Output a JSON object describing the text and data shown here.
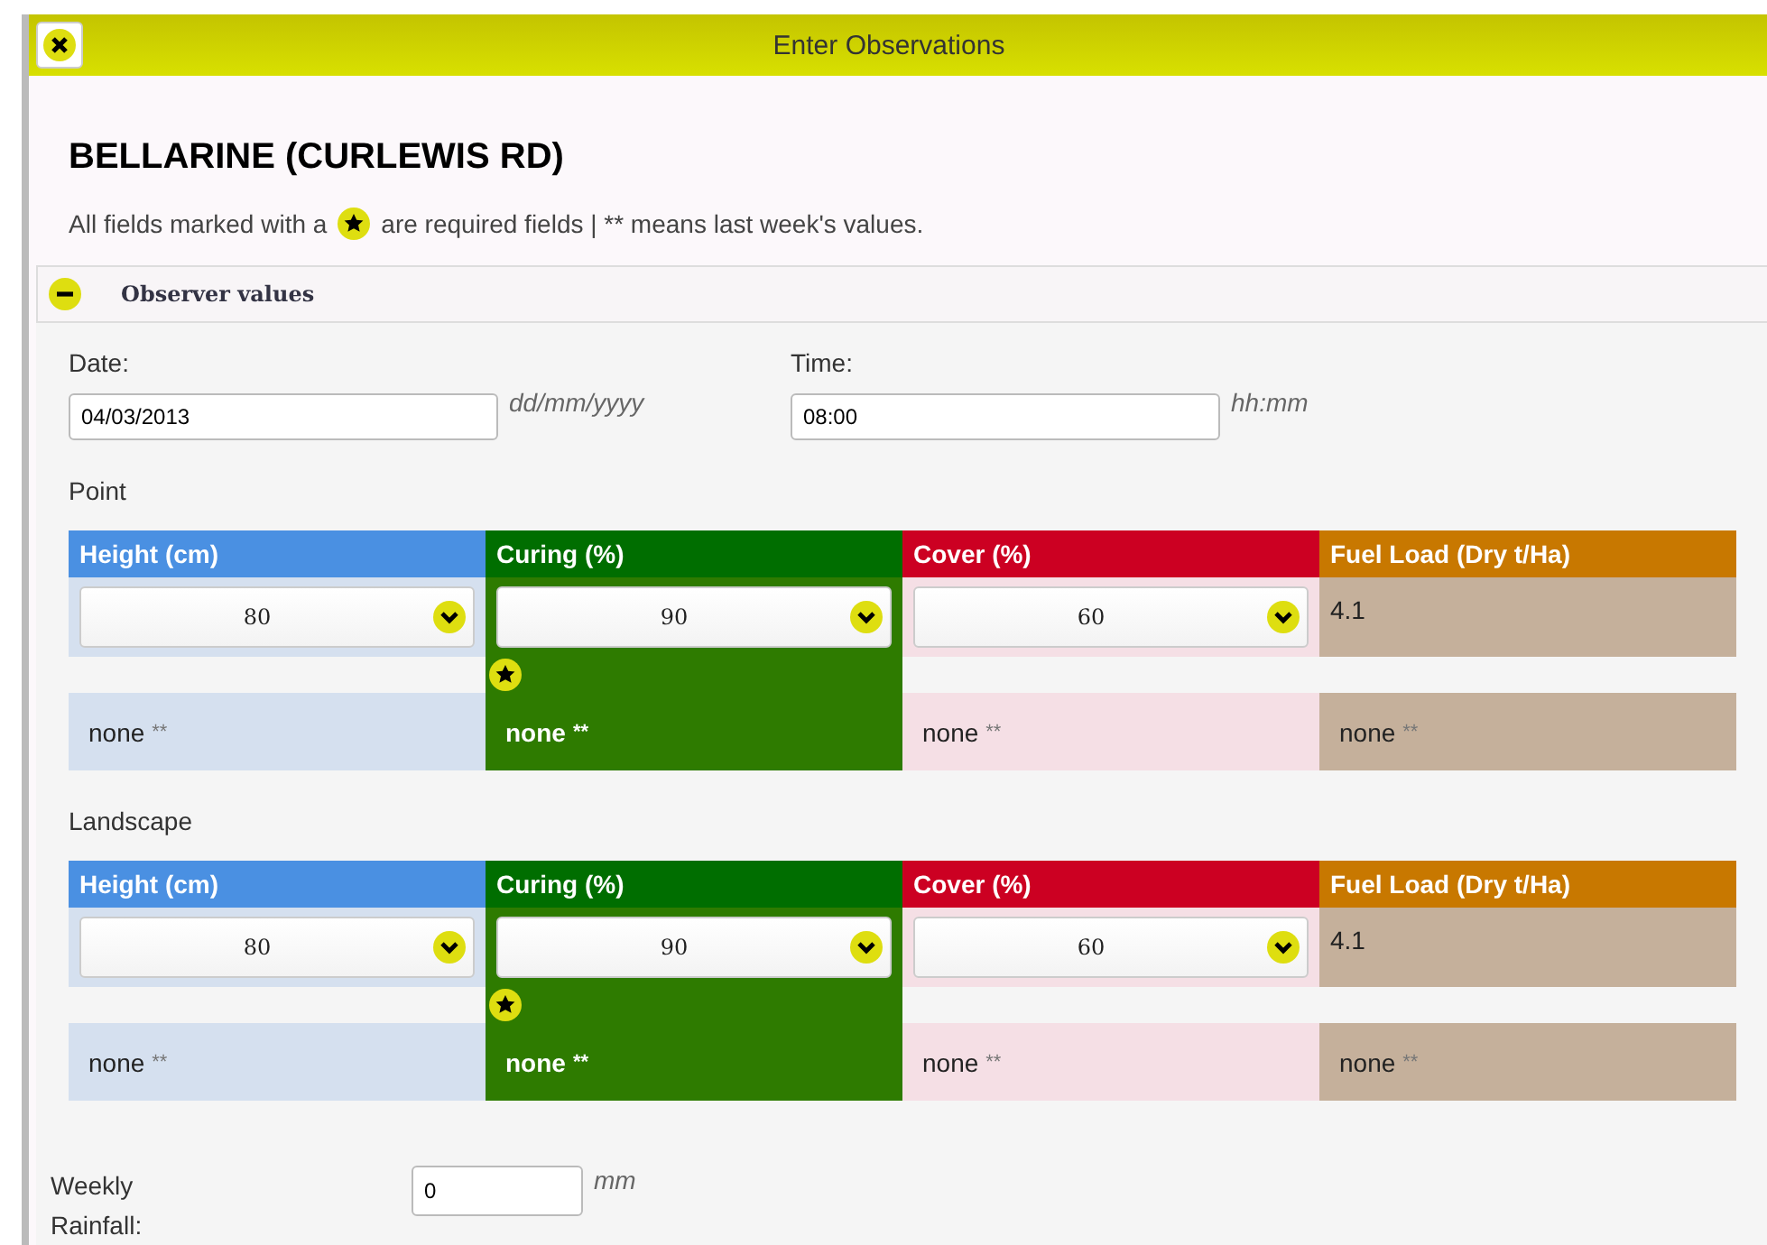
{
  "window": {
    "title": "Enter Observations"
  },
  "heading": "BELLARINE (CURLEWIS RD)",
  "note_before": "All fields marked with a",
  "note_after": "are required fields | ** means last week's values.",
  "section": {
    "title": "Observer values",
    "expanded": true
  },
  "date": {
    "label": "Date:",
    "value": "04/03/2013",
    "hint": "dd/mm/yyyy"
  },
  "time": {
    "label": "Time:",
    "value": "08:00",
    "hint": "hh:mm"
  },
  "groups": [
    {
      "title": "Point",
      "columns": [
        {
          "header": "Height (cm)",
          "color": "#4a90e2",
          "kind": "select",
          "value": "80",
          "required": false,
          "last": "none",
          "last_mark": "**"
        },
        {
          "header": "Curing (%)",
          "color": "#006e00",
          "kind": "select",
          "value": "90",
          "required": true,
          "last": "none",
          "last_mark": "**"
        },
        {
          "header": "Cover (%)",
          "color": "#cc0022",
          "kind": "select",
          "value": "60",
          "required": false,
          "last": "none",
          "last_mark": "**"
        },
        {
          "header": "Fuel Load (Dry t/Ha)",
          "color": "#c87800",
          "kind": "value",
          "value": "4.1",
          "required": false,
          "last": "none",
          "last_mark": "**"
        }
      ]
    },
    {
      "title": "Landscape",
      "columns": [
        {
          "header": "Height (cm)",
          "color": "#4a90e2",
          "kind": "select",
          "value": "80",
          "required": false,
          "last": "none",
          "last_mark": "**"
        },
        {
          "header": "Curing (%)",
          "color": "#006e00",
          "kind": "select",
          "value": "90",
          "required": true,
          "last": "none",
          "last_mark": "**"
        },
        {
          "header": "Cover (%)",
          "color": "#cc0022",
          "kind": "select",
          "value": "60",
          "required": false,
          "last": "none",
          "last_mark": "**"
        },
        {
          "header": "Fuel Load (Dry t/Ha)",
          "color": "#c87800",
          "kind": "value",
          "value": "4.1",
          "required": false,
          "last": "none",
          "last_mark": "**"
        }
      ]
    }
  ],
  "rainfall": {
    "label": "Weekly Rainfall:",
    "value": "0",
    "unit": "mm"
  }
}
